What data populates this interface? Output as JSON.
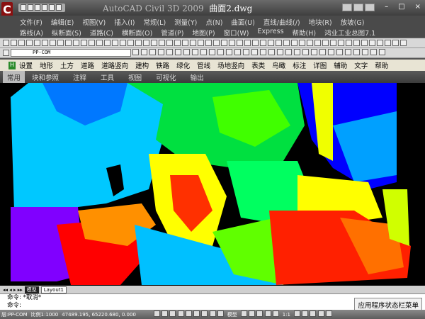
{
  "titlebar": {
    "app": "AutoCAD Civil 3D 2009",
    "file": "曲面2.dwg",
    "logo": "C"
  },
  "menu1": [
    "文件(F)",
    "编辑(E)",
    "视图(V)",
    "插入(I)",
    "常规(L)",
    "测量(Y)",
    "点(N)",
    "曲面(U)",
    "直线/曲线(/)",
    "地块(R)",
    "放坡(G)"
  ],
  "menu2": [
    "路线(A)",
    "纵断面(S)",
    "道路(C)",
    "横断面(O)",
    "管道(P)",
    "地图(P)",
    "窗口(W)",
    "Express",
    "帮助(H)",
    "鸿业工业总图7.1"
  ],
  "layer": {
    "value": "PP-COM"
  },
  "custom_menu": {
    "icon": "H",
    "items": [
      "设置",
      "地形",
      "土方",
      "道路",
      "道路竖向",
      "建构",
      "铁路",
      "绿化",
      "管线",
      "场地竖向",
      "表类",
      "鸟瞰",
      "标注",
      "详图",
      "辅助",
      "文字",
      "帮助"
    ]
  },
  "ribbon": {
    "tabs": [
      "常用",
      "块和参照",
      "注释",
      "工具",
      "视图",
      "可视化",
      "输出"
    ],
    "active": "常用"
  },
  "layout_tabs": [
    "模型",
    "Layout1"
  ],
  "command": {
    "lines": [
      "命令: *取消*",
      "命令:"
    ]
  },
  "tooltip": "应用程序状态栏菜单",
  "status": {
    "layer": "层:PP-COM",
    "scale": "比例1:1000",
    "coords": "47489.195, 65220.680, 0.000",
    "model": "模型",
    "annoscale": "1:1"
  }
}
